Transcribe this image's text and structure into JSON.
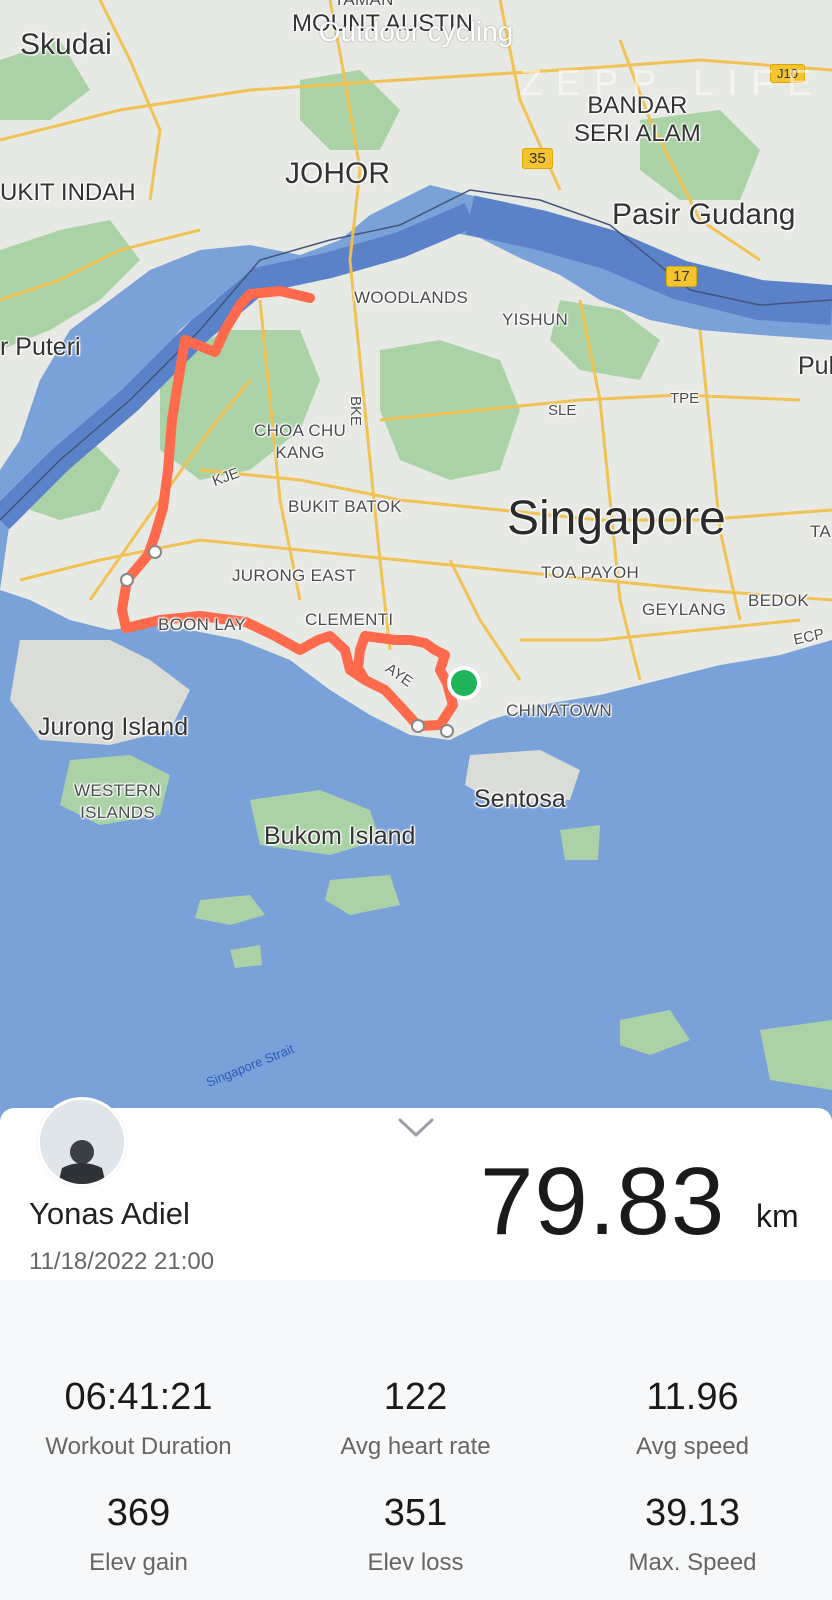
{
  "header": {
    "title": "Outdoor cycling",
    "watermark": "ZEPP LIFE"
  },
  "map": {
    "colors": {
      "water": "#7ba1d9",
      "land": "#e8eae6",
      "green": "#aad2a6",
      "route": "#ff6a4d",
      "start": "#1fb45a"
    },
    "labels": {
      "taman": "TAMAN",
      "mount_austin": "MOUNT AUSTIN",
      "skudai": "Skudai",
      "johor": "JOHOR",
      "bandar_seri_alam": "BANDAR\nSERI ALAM",
      "bukit_indah": "UKIT INDAH",
      "pasir_gudang": "Pasir Gudang",
      "puteri": "r Puteri",
      "woodlands": "WOODLANDS",
      "yishun": "YISHUN",
      "pul": "Pul",
      "choa_chu_kang": "CHOA CHU\nKANG",
      "bukit_batok": "BUKIT BATOK",
      "singapore": "Singapore",
      "ta": "TA",
      "jurong_east": "JURONG EAST",
      "toa_payoh": "TOA PAYOH",
      "clementi": "CLEMENTI",
      "boon_lay": "BOON LAY",
      "geylang": "GEYLANG",
      "bedok": "BEDOK",
      "chinatown": "CHINATOWN",
      "jurong_island": "Jurong Island",
      "western_islands": "WESTERN\nISLANDS",
      "sentosa": "Sentosa",
      "bukom_island": "Bukom Island",
      "singapore_strait": "Singapore Strait",
      "road_bke": "BKE",
      "road_sle": "SLE",
      "road_tpe": "TPE",
      "road_kje": "KJE",
      "road_aye": "AYE",
      "road_ecp": "ECP",
      "shield_35": "35",
      "shield_17": "17",
      "shield_j10": "J10"
    }
  },
  "workout": {
    "user_name": "Yonas Adiel",
    "datetime": "11/18/2022 21:00",
    "distance": "79.83",
    "distance_unit": "km"
  },
  "stats": [
    {
      "value": "06:41:21",
      "label": "Workout Duration"
    },
    {
      "value": "122",
      "label": "Avg heart rate"
    },
    {
      "value": "11.96",
      "label": "Avg speed"
    },
    {
      "value": "369",
      "label": "Elev gain"
    },
    {
      "value": "351",
      "label": "Elev loss"
    },
    {
      "value": "39.13",
      "label": "Max. Speed"
    }
  ]
}
